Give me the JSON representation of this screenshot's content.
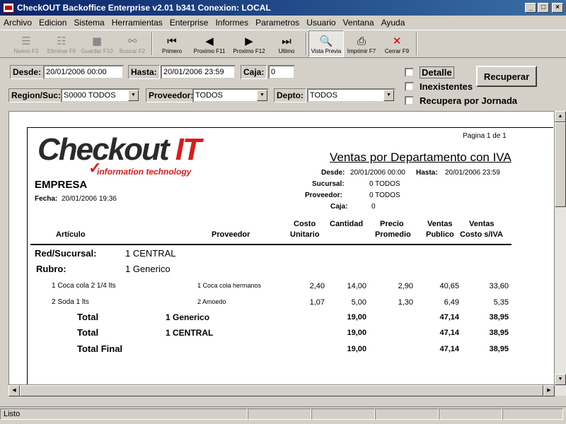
{
  "window": {
    "title": "CheckOUT Backoffice Enterprise v2.01 b341 Conexion: LOCAL",
    "minimize": "_",
    "maximize": "□",
    "close": "×"
  },
  "menu": [
    "Archivo",
    "Edicion",
    "Sistema",
    "Herramientas",
    "Enterprise",
    "Informes",
    "Parametros",
    "Usuario",
    "Ventana",
    "Ayuda"
  ],
  "toolbar": {
    "nuevo": "Nuevo F3",
    "eliminar": "Eliminar F6",
    "guardar": "Guardar F10",
    "buscar": "Buscar F2",
    "primero": "Primero",
    "proximo_f11": "Proximo F11",
    "proximo_f12": "Proximo F12",
    "ultimo": "Ultimo",
    "vista_previa": "Vista Previa",
    "imprimir": "Imprimir F7",
    "cerrar": "Cerrar F9"
  },
  "filters": {
    "desde_label": "Desde:",
    "desde_value": "20/01/2006 00:00",
    "hasta_label": "Hasta:",
    "hasta_value": "20/01/2006 23:59",
    "caja_label": "Caja:",
    "caja_value": "0",
    "region_label": "Region/Suc:",
    "region_value": "S0000 TODOS",
    "proveedor_label": "Proveedor:",
    "proveedor_value": "TODOS",
    "depto_label": "Depto:",
    "depto_value": "TODOS",
    "detalle": "Detalle",
    "inexistentes": "Inexistentes",
    "recupera_jornada": "Recupera por Jornada",
    "recuperar": "Recuperar"
  },
  "report": {
    "page_info": "Pagina 1 de 1",
    "logo_main": "Checkout",
    "logo_it": "IT",
    "logo_sub": "information technology",
    "title": "Ventas por Departamento con IVA",
    "empresa": "EMPRESA",
    "fecha_label": "Fecha:",
    "fecha_value": "20/01/2006 19:36",
    "desde_label": "Desde:",
    "desde_value": "20/01/2006 00:00",
    "hasta_label": "Hasta:",
    "hasta_value": "20/01/2006 23:59",
    "sucursal_label": "Sucursal:",
    "sucursal_value": "0 TODOS",
    "proveedor_label": "Proveedor:",
    "proveedor_value": "0 TODOS",
    "caja_label": "Caja:",
    "caja_value": "0",
    "columns": {
      "articulo": "Artículo",
      "proveedor": "Proveedor",
      "costo_1": "Costo",
      "costo_2": "Unitario",
      "cantidad": "Cantidad",
      "precio_1": "Precio",
      "precio_2": "Promedio",
      "ventas_pub_1": "Ventas",
      "ventas_pub_2": "Publico",
      "ventas_costo_1": "Ventas",
      "ventas_costo_2": "Costo s/IVA"
    },
    "red_label": "Red/Sucursal:",
    "red_value": "1  CENTRAL",
    "rubro_label": "Rubro:",
    "rubro_value": "1  Generico",
    "rows": [
      {
        "articulo": "1 Coca cola 2 1/4 lts",
        "proveedor": "1 Coca cola hermanos",
        "costo": "2,40",
        "cantidad": "14,00",
        "precio": "2,90",
        "ventas_pub": "40,65",
        "ventas_costo": "33,60"
      },
      {
        "articulo": "2 Soda 1 lts",
        "proveedor": "2 Amoedo",
        "costo": "1,07",
        "cantidad": "5,00",
        "precio": "1,30",
        "ventas_pub": "6,49",
        "ventas_costo": "5,35"
      }
    ],
    "totals": [
      {
        "label": "Total",
        "group": "1 Generico",
        "cantidad": "19,00",
        "ventas_pub": "47,14",
        "ventas_costo": "38,95"
      },
      {
        "label": "Total",
        "group": "1 CENTRAL",
        "cantidad": "19,00",
        "ventas_pub": "47,14",
        "ventas_costo": "38,95"
      },
      {
        "label": "Total Final",
        "group": "",
        "cantidad": "19,00",
        "ventas_pub": "47,14",
        "ventas_costo": "38,95"
      }
    ]
  },
  "status": {
    "text": "Listo"
  }
}
